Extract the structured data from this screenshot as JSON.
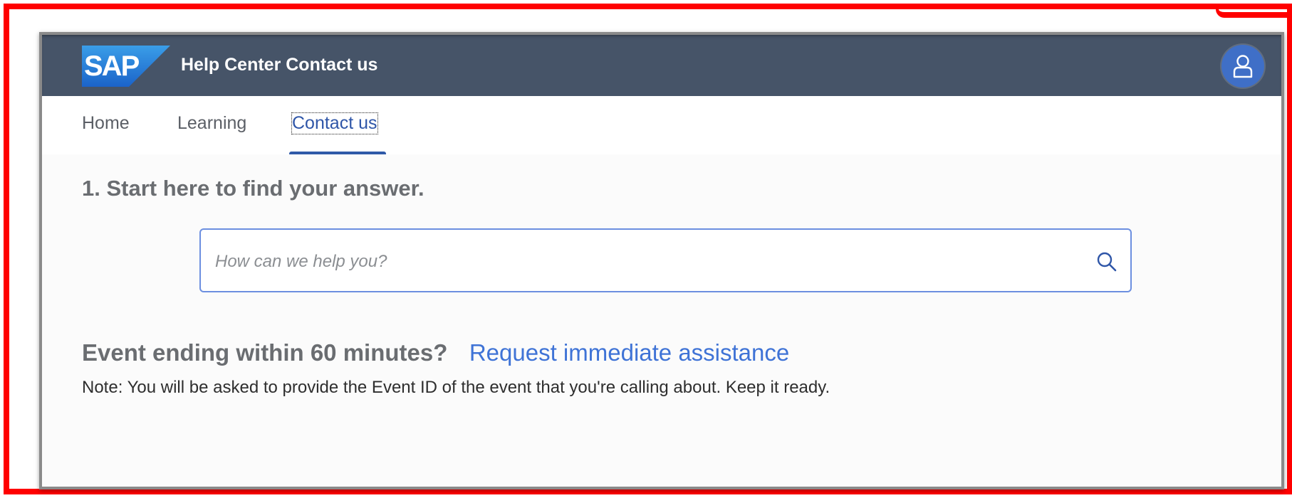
{
  "colors": {
    "shell_bg": "#465468",
    "accent": "#2f5aa8",
    "link": "#3f73d6",
    "frame": "#ff0000"
  },
  "shell": {
    "logo_text": "SAP",
    "title": "Help Center Contact us",
    "avatar_icon": "user-icon"
  },
  "tabs": [
    {
      "label": "Home"
    },
    {
      "label": "Learning"
    },
    {
      "label": "Contact us",
      "active": true
    }
  ],
  "main": {
    "step_heading": "1. Start here to find your answer.",
    "search": {
      "placeholder": "How can we help you?",
      "value": "",
      "icon": "search-icon"
    },
    "event_question": "Event ending within 60 minutes?",
    "assist_link": "Request immediate assistance",
    "note": "Note: You will be asked to provide the Event ID of the event that you're calling about. Keep it ready."
  }
}
